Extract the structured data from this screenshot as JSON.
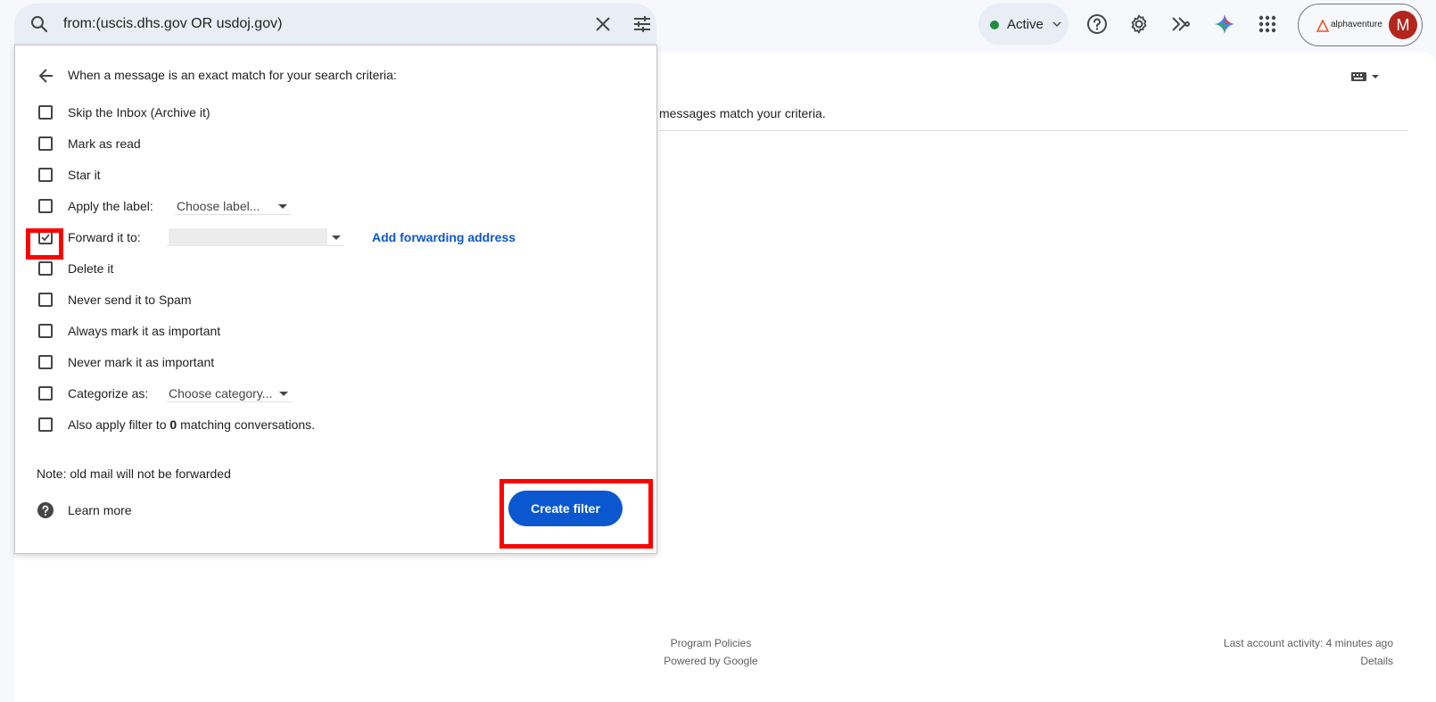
{
  "search": {
    "query": "from:(uscis.dhs.gov OR usdoj.gov)",
    "icons": [
      "search-icon",
      "close-icon",
      "tune-icon"
    ]
  },
  "status": {
    "label": "Active",
    "color": "#1e8e3e"
  },
  "account": {
    "org": "alphaventure",
    "avatar_letter": "M",
    "avatar_color": "#b3261e"
  },
  "main": {
    "no_match_text": "messages match your criteria."
  },
  "filter_panel": {
    "heading": "When a message is an exact match for your search criteria:",
    "options": [
      {
        "label": "Skip the Inbox (Archive it)",
        "checked": false
      },
      {
        "label": "Mark as read",
        "checked": false
      },
      {
        "label": "Star it",
        "checked": false
      },
      {
        "label": "Apply the label:",
        "checked": false,
        "dropdown": "Choose label..."
      },
      {
        "label": "Forward it to:",
        "checked": true,
        "link": "Add forwarding address"
      },
      {
        "label": "Delete it",
        "checked": false
      },
      {
        "label": "Never send it to Spam",
        "checked": false
      },
      {
        "label": "Always mark it as important",
        "checked": false
      },
      {
        "label": "Never mark it as important",
        "checked": false
      },
      {
        "label": "Categorize as:",
        "checked": false,
        "dropdown": "Choose category..."
      },
      {
        "label_prefix": "Also apply filter to ",
        "count": "0",
        "label_suffix": " matching conversations.",
        "checked": false
      }
    ],
    "note": "Note: old mail will not be forwarded",
    "learn_more": "Learn more",
    "create_button": "Create filter",
    "accent_color": "#0b57d0"
  },
  "footer": {
    "program_policies": "Program Policies",
    "powered_by": "Powered by Google",
    "last_activity": "Last account activity: 4 minutes ago",
    "details": "Details"
  }
}
